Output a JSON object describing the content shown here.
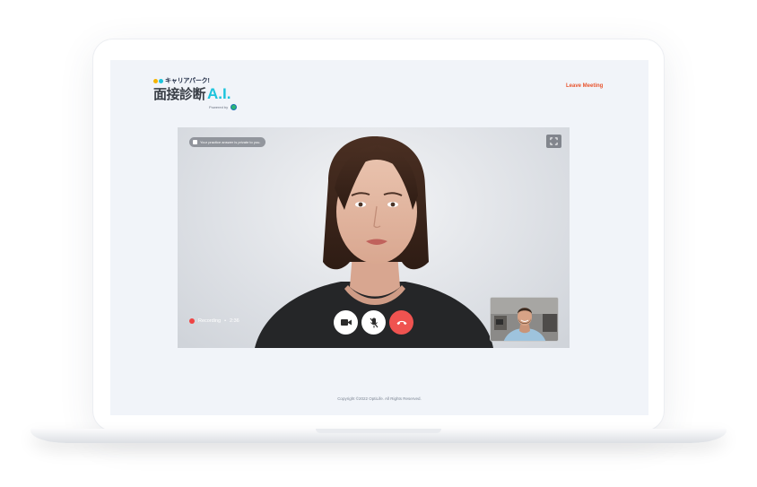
{
  "header": {
    "logo": {
      "brand": "キャリアパーク!",
      "title_jp": "面接診断",
      "title_ai": "A.I.",
      "powered_by": "Powered by"
    },
    "leave_label": "Leave Meeting"
  },
  "video": {
    "privacy_notice": "Your practice answer is private to you.",
    "recording_label": "Recording",
    "recording_separator": "•",
    "recording_time": "2:36",
    "controls": [
      {
        "name": "camera-button",
        "icon": "video-camera-icon"
      },
      {
        "name": "mute-button",
        "icon": "mic-off-icon"
      },
      {
        "name": "end-call-button",
        "icon": "phone-hangup-icon"
      }
    ]
  },
  "footer": {
    "copyright": "Copyright ©2022 OptiLife. All Rights Reserved."
  },
  "colors": {
    "accent_orange": "#e8542e",
    "recording_red": "#ef4444",
    "hangup_red": "#ef5350",
    "logo_cyan": "#1dc4dc",
    "logo_yellow": "#f5b400",
    "screen_bg": "#f1f4f9"
  }
}
